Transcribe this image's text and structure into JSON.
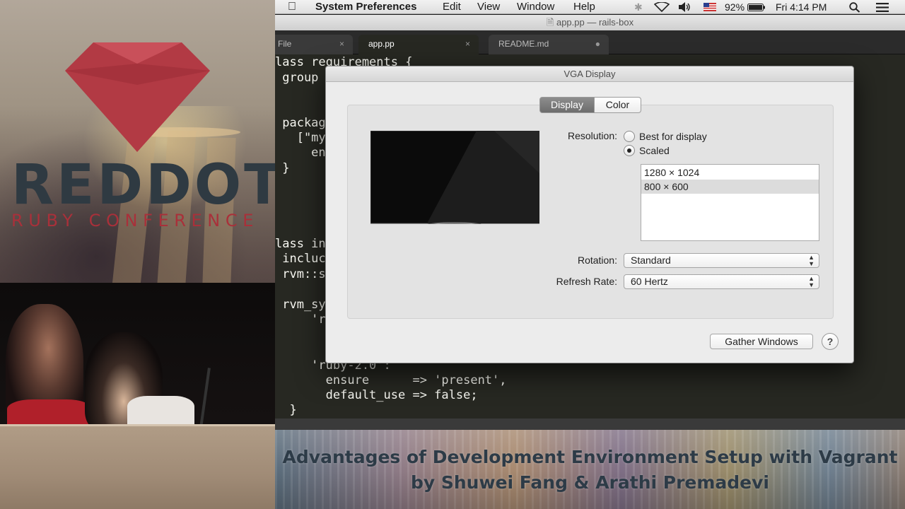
{
  "conference": {
    "logo_word": "REDDOT",
    "logo_subtitle": "RUBY CONFERENCE",
    "brand_color": "#a9303a"
  },
  "talk": {
    "title_line1": "Advantages of Development Environment Setup with Vagrant",
    "title_line2": "by Shuwei Fang & Arathi Premadevi"
  },
  "menubar": {
    "apple_icon": "apple-icon",
    "app_name": "System Preferences",
    "items": [
      "Edit",
      "View",
      "Window",
      "Help"
    ],
    "battery": "92%",
    "clock": "Fri 4:14 PM"
  },
  "window": {
    "title": "app.pp — rails-box",
    "tabs": [
      {
        "label": "File",
        "close": "×"
      },
      {
        "label": "app.pp",
        "close": "×"
      },
      {
        "label": "README.md",
        "close": "●"
      }
    ]
  },
  "code": {
    "lines": [
      "lass requirements {",
      " group",
      "",
      "",
      " packag",
      "   [\"my",
      "     en",
      " }",
      "",
      "",
      "",
      "",
      "lass in",
      " incluc",
      " rvm::s",
      "",
      " rvm_sy",
      "     'r",
      "",
      "",
      "",
      "     'ruby-2.0':",
      "       ensure      => 'present',",
      "       default_use => false;",
      "  }"
    ]
  },
  "dialog": {
    "title": "VGA Display",
    "tabs": {
      "display": "Display",
      "color": "Color"
    },
    "resolution_label": "Resolution:",
    "resolution_options": {
      "best": "Best for display",
      "scaled": "Scaled"
    },
    "resolutions": [
      "1280 × 1024",
      "800 × 600"
    ],
    "rotation_label": "Rotation:",
    "rotation_value": "Standard",
    "refresh_label": "Refresh Rate:",
    "refresh_value": "60 Hertz",
    "gather_button": "Gather Windows",
    "help_button": "?"
  }
}
